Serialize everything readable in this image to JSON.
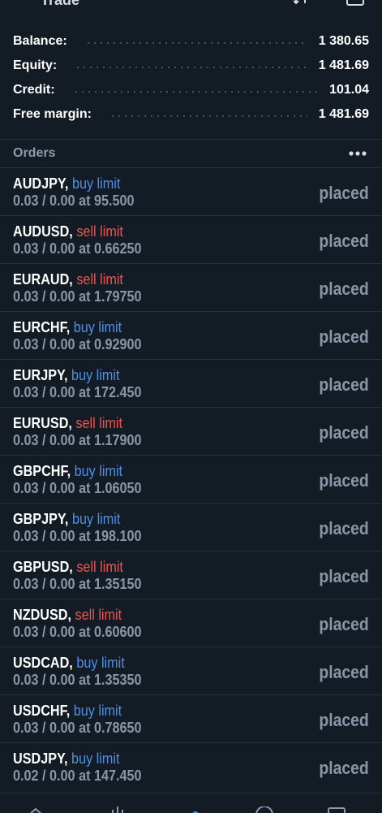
{
  "header": {
    "title": "Trade"
  },
  "account": {
    "rows": [
      {
        "label": "Balance:",
        "value": "1 380.65"
      },
      {
        "label": "Equity:",
        "value": "1 481.69"
      },
      {
        "label": "Credit:",
        "value": "101.04"
      },
      {
        "label": "Free margin:",
        "value": "1 481.69"
      }
    ]
  },
  "orders": {
    "title": "Orders",
    "items": [
      {
        "symbol": "AUDJPY,",
        "type": "buy limit",
        "side": "buy",
        "details": "0.03 / 0.00 at 95.500",
        "status": "placed"
      },
      {
        "symbol": "AUDUSD,",
        "type": "sell limit",
        "side": "sell",
        "details": "0.03 / 0.00 at 0.66250",
        "status": "placed"
      },
      {
        "symbol": "EURAUD,",
        "type": "sell limit",
        "side": "sell",
        "details": "0.03 / 0.00 at 1.79750",
        "status": "placed"
      },
      {
        "symbol": "EURCHF,",
        "type": "buy limit",
        "side": "buy",
        "details": "0.03 / 0.00 at 0.92900",
        "status": "placed"
      },
      {
        "symbol": "EURJPY,",
        "type": "buy limit",
        "side": "buy",
        "details": "0.03 / 0.00 at 172.450",
        "status": "placed"
      },
      {
        "symbol": "EURUSD,",
        "type": "sell limit",
        "side": "sell",
        "details": "0.03 / 0.00 at 1.17900",
        "status": "placed"
      },
      {
        "symbol": "GBPCHF,",
        "type": "buy limit",
        "side": "buy",
        "details": "0.03 / 0.00 at 1.06050",
        "status": "placed"
      },
      {
        "symbol": "GBPJPY,",
        "type": "buy limit",
        "side": "buy",
        "details": "0.03 / 0.00 at 198.100",
        "status": "placed"
      },
      {
        "symbol": "GBPUSD,",
        "type": "sell limit",
        "side": "sell",
        "details": "0.03 / 0.00 at 1.35150",
        "status": "placed"
      },
      {
        "symbol": "NZDUSD,",
        "type": "sell limit",
        "side": "sell",
        "details": "0.03 / 0.00 at 0.60600",
        "status": "placed"
      },
      {
        "symbol": "USDCAD,",
        "type": "buy limit",
        "side": "buy",
        "details": "0.03 / 0.00 at 1.35350",
        "status": "placed"
      },
      {
        "symbol": "USDCHF,",
        "type": "buy limit",
        "side": "buy",
        "details": "0.03 / 0.00 at 0.78650",
        "status": "placed"
      },
      {
        "symbol": "USDJPY,",
        "type": "buy limit",
        "side": "buy",
        "details": "0.02 / 0.00 at 147.450",
        "status": "placed"
      }
    ]
  },
  "icons": {
    "sort": "sort-icon",
    "new_order": "new-order-icon",
    "more": "more-options-icon",
    "nav": [
      "quotes-icon",
      "chart-icon",
      "trade-icon",
      "history-icon",
      "messages-icon"
    ]
  },
  "colors": {
    "background": "#131b25",
    "buy": "#4f8fe6",
    "sell": "#ef5350",
    "muted": "#8b96a4",
    "divider": "#27313d"
  }
}
